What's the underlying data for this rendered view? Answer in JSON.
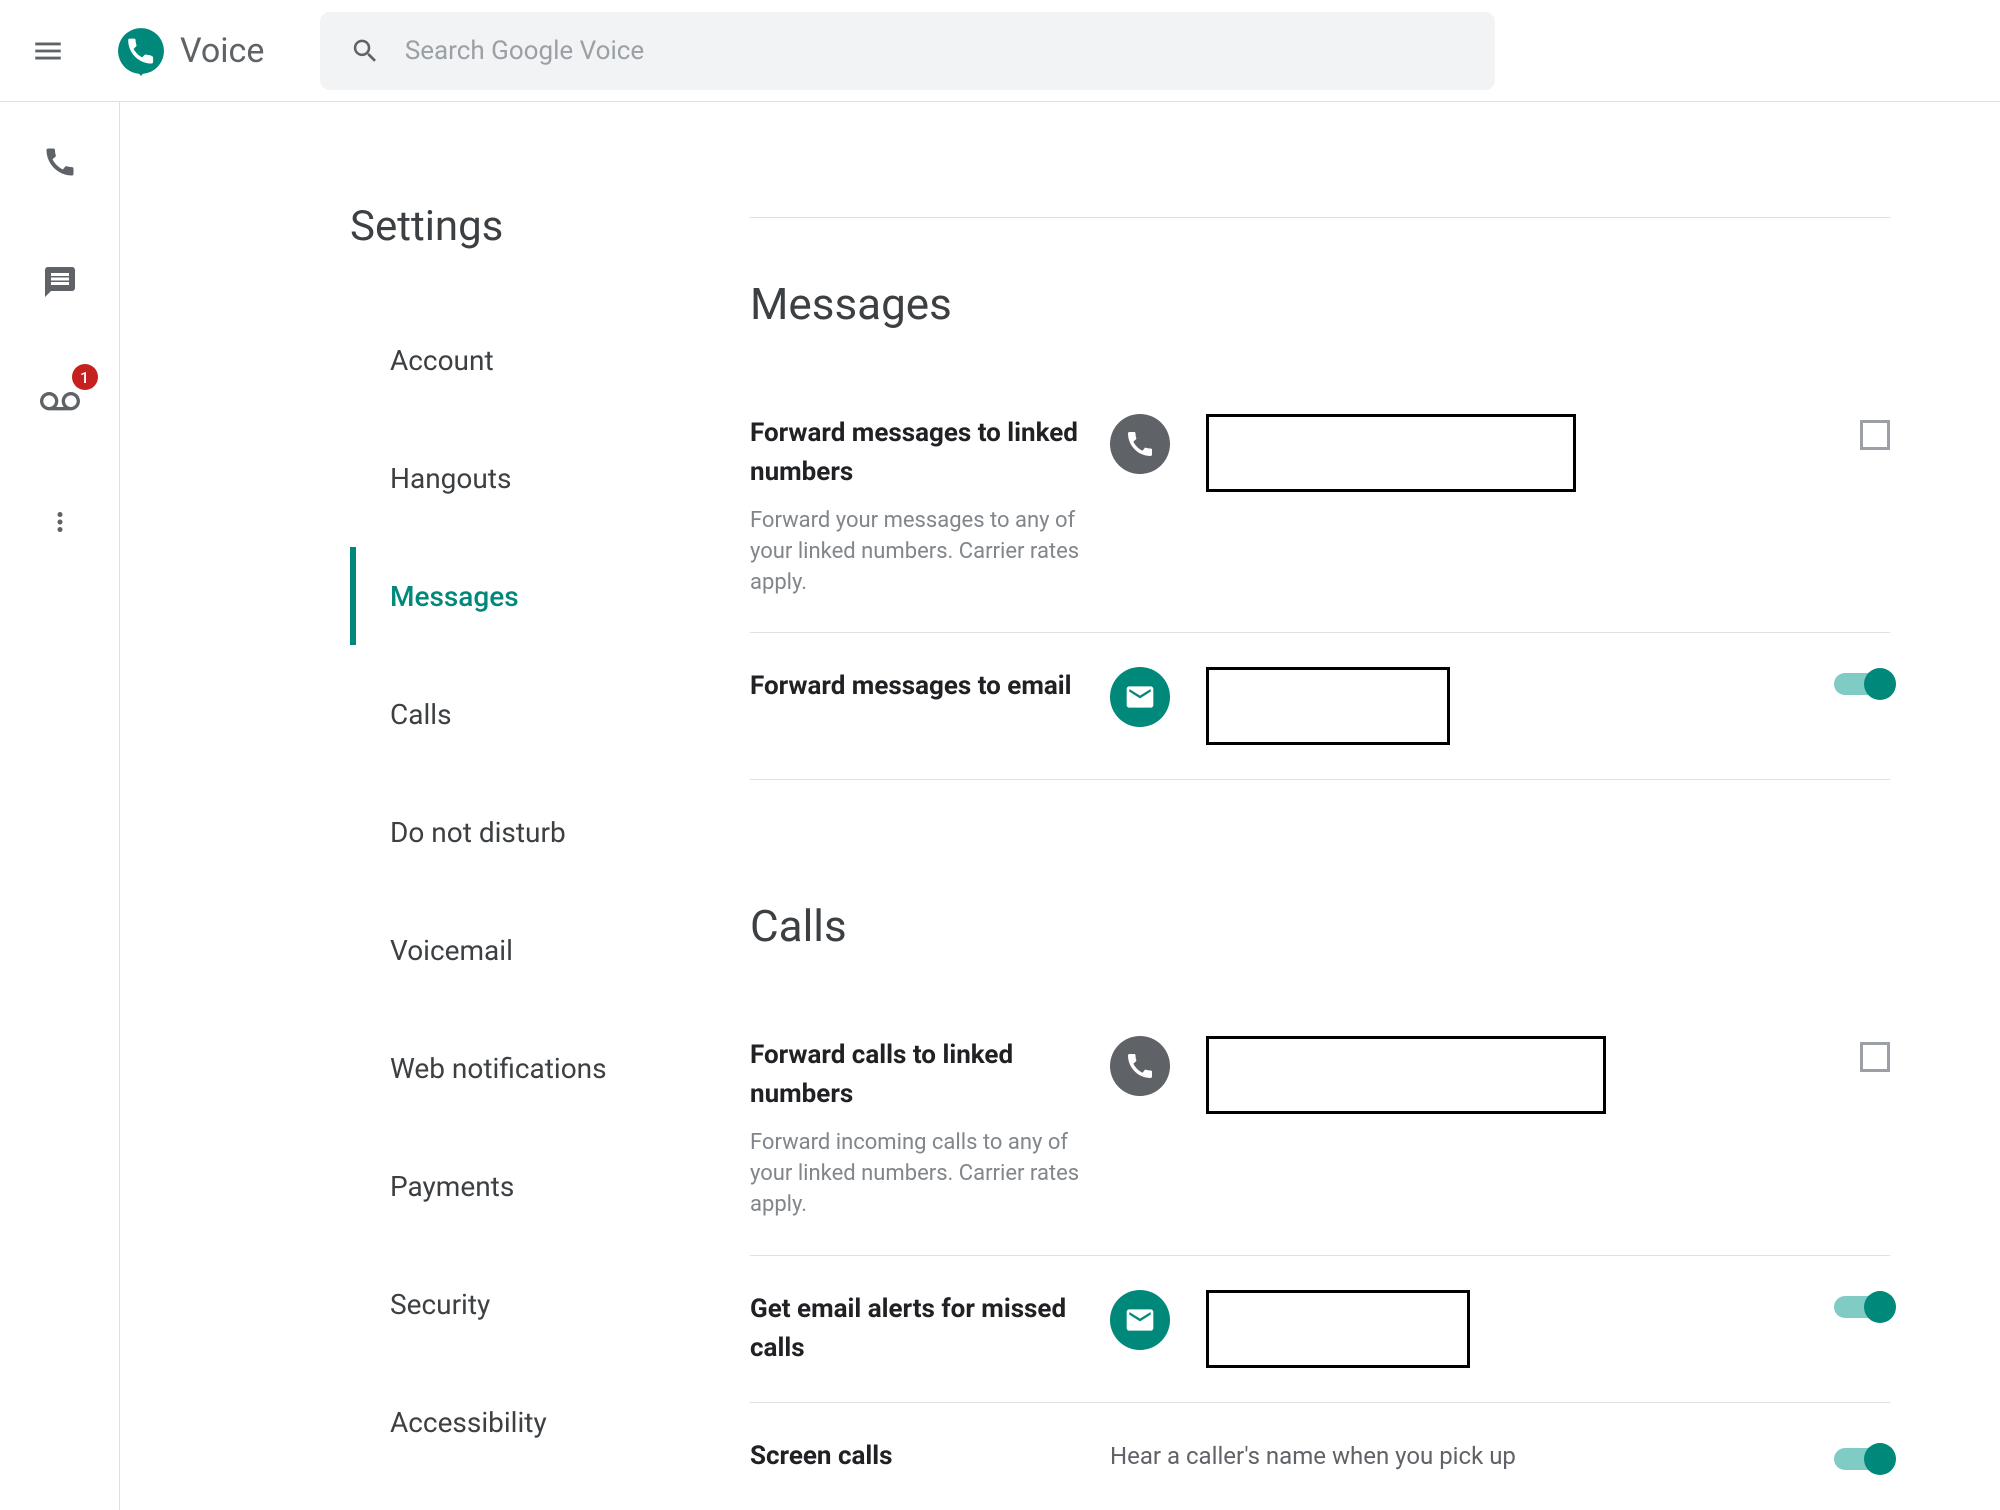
{
  "header": {
    "app_name": "Voice",
    "search_placeholder": "Search Google Voice",
    "voicemail_badge": "1"
  },
  "settings": {
    "title": "Settings",
    "nav_items": [
      {
        "label": "Account",
        "active": false
      },
      {
        "label": "Hangouts",
        "active": false
      },
      {
        "label": "Messages",
        "active": true
      },
      {
        "label": "Calls",
        "active": false
      },
      {
        "label": "Do not disturb",
        "active": false
      },
      {
        "label": "Voicemail",
        "active": false
      },
      {
        "label": "Web notifications",
        "active": false
      },
      {
        "label": "Payments",
        "active": false
      },
      {
        "label": "Security",
        "active": false
      },
      {
        "label": "Accessibility",
        "active": false
      }
    ]
  },
  "sections": {
    "messages": {
      "title": "Messages",
      "forward_linked": {
        "label": "Forward messages to linked numbers",
        "description": "Forward your messages to any of your linked numbers. Carrier rates apply."
      },
      "forward_email": {
        "label": "Forward messages to email"
      }
    },
    "calls": {
      "title": "Calls",
      "forward_linked": {
        "label": "Forward calls to linked numbers",
        "description": "Forward incoming calls to any of your linked numbers. Carrier rates apply."
      },
      "missed_email": {
        "label": "Get email alerts for missed calls"
      },
      "screen": {
        "label": "Screen calls",
        "description": "Hear a caller's name when you pick up"
      }
    }
  }
}
